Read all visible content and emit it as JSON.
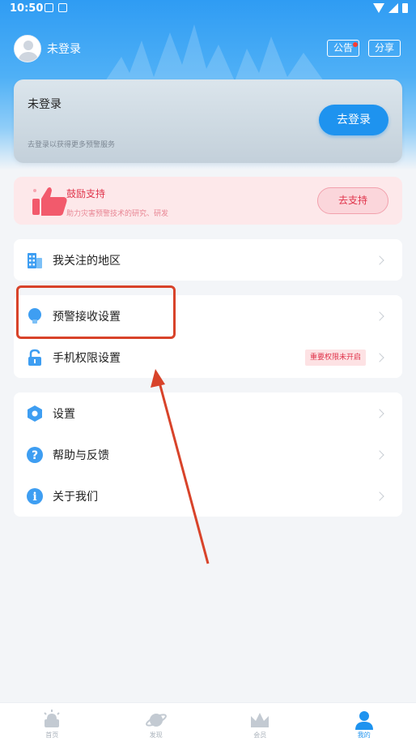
{
  "status_bar": {
    "time": "10:50"
  },
  "profile": {
    "name": "未登录"
  },
  "header_buttons": {
    "notice": "公告",
    "share": "分享"
  },
  "login_card": {
    "title": "未登录",
    "subtitle": "去登录以获得更多预警服务",
    "button": "去登录"
  },
  "support_card": {
    "title": "鼓励支持",
    "subtitle": "助力灾害预警技术的研究、研发",
    "button": "去支持"
  },
  "menu_group1": {
    "items": [
      {
        "label": "我关注的地区",
        "icon": "building-icon"
      }
    ]
  },
  "menu_group2": {
    "items": [
      {
        "label": "预警接收设置",
        "icon": "lightbulb-icon"
      },
      {
        "label": "手机权限设置",
        "icon": "lock-icon",
        "badge": "重要权限未开启"
      }
    ]
  },
  "menu_group3": {
    "items": [
      {
        "label": "设置",
        "icon": "hexagon-gear-icon"
      },
      {
        "label": "帮助与反馈",
        "icon": "question-icon"
      },
      {
        "label": "关于我们",
        "icon": "info-icon"
      }
    ]
  },
  "tabbar": {
    "items": [
      {
        "label": "首页",
        "icon": "alarm-icon"
      },
      {
        "label": "发现",
        "icon": "planet-icon"
      },
      {
        "label": "会员",
        "icon": "crown-icon"
      },
      {
        "label": "我的",
        "icon": "person-icon",
        "active": true
      }
    ]
  },
  "colors": {
    "accent": "#1e93ef",
    "support": "#e0334a",
    "annotation": "#d8432a"
  }
}
